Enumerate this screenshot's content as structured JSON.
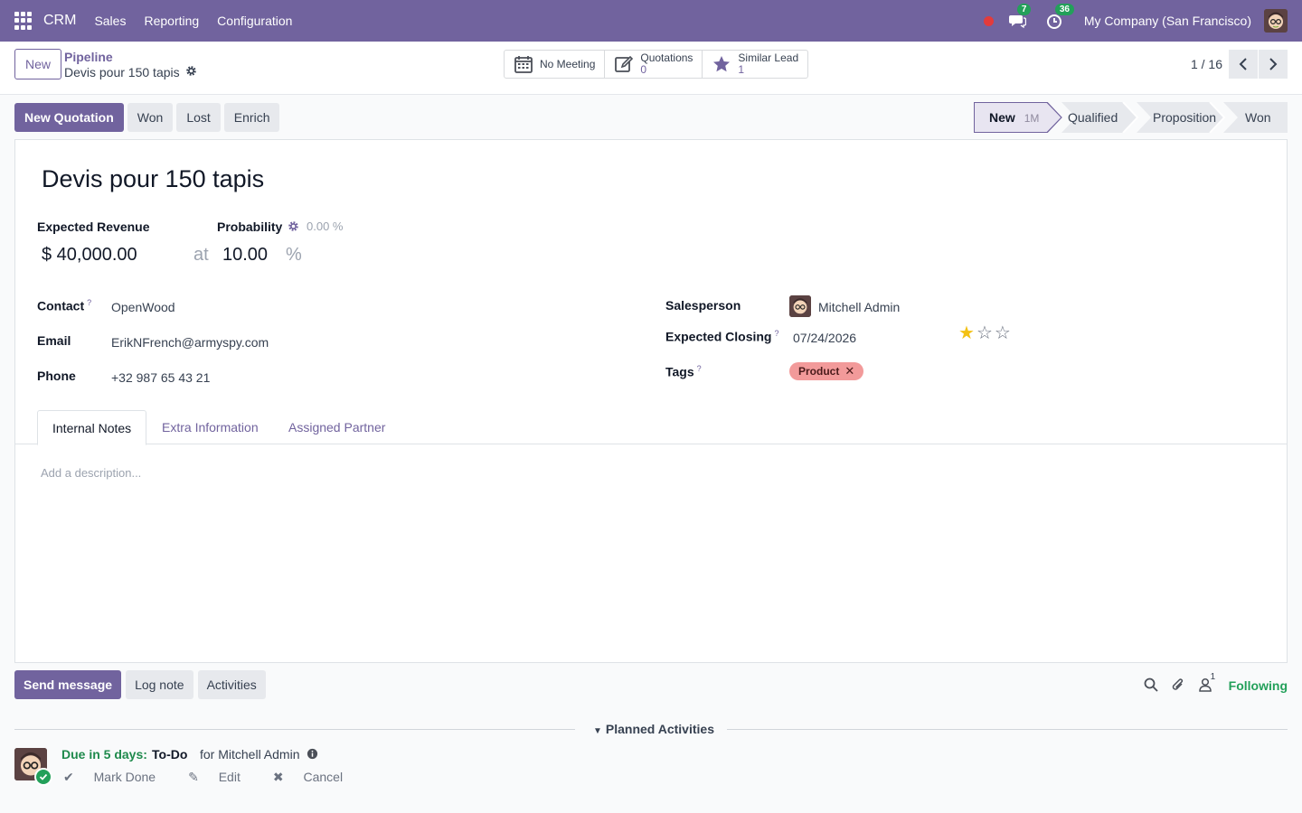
{
  "navbar": {
    "brand": "CRM",
    "menu": [
      "Sales",
      "Reporting",
      "Configuration"
    ],
    "messages_count": "7",
    "activities_count": "36",
    "company": "My Company (San Francisco)",
    "bg_color": "#71639e"
  },
  "control": {
    "new_label": "New",
    "breadcrumb": "Pipeline",
    "record_title": "Devis pour 150 tapis",
    "smart": {
      "meeting_label": "No Meeting",
      "quotations_label": "Quotations",
      "quotations_count": "0",
      "similar_label": "Similar Lead",
      "similar_count": "1"
    },
    "pager": "1 / 16"
  },
  "actions": {
    "new_quotation": "New Quotation",
    "won": "Won",
    "lost": "Lost",
    "enrich": "Enrich"
  },
  "stages": [
    {
      "label": "New",
      "duration": "1M",
      "active": true
    },
    {
      "label": "Qualified"
    },
    {
      "label": "Proposition"
    },
    {
      "label": "Won"
    }
  ],
  "lead": {
    "name": "Devis pour 150 tapis",
    "expected_revenue_label": "Expected Revenue",
    "expected_revenue": "$ 40,000.00",
    "at": "at",
    "probability_label": "Probability",
    "auto_probability": "0.00 %",
    "probability": "10.00",
    "percent": "%",
    "contact_label": "Contact",
    "contact": "OpenWood",
    "email_label": "Email",
    "email": "ErikNFrench@armyspy.com",
    "phone_label": "Phone",
    "phone": "+32 987 65 43 21",
    "salesperson_label": "Salesperson",
    "salesperson": "Mitchell Admin",
    "expected_closing_label": "Expected Closing",
    "expected_closing": "07/24/2026",
    "priority_stars": 1,
    "priority_max": 3,
    "tags_label": "Tags",
    "tag": "Product",
    "help_mark": "?"
  },
  "tabs": [
    "Internal Notes",
    "Extra Information",
    "Assigned Partner"
  ],
  "description_placeholder": "Add a description...",
  "chatter": {
    "send_message": "Send message",
    "log_note": "Log note",
    "activities": "Activities",
    "followers_count": "1",
    "following": "Following",
    "planned_title": "Planned Activities",
    "due": "Due in 5 days:",
    "activity_type": "To-Do",
    "for": "for Mitchell Admin",
    "mark_done": "Mark Done",
    "edit": "Edit",
    "cancel": "Cancel"
  }
}
